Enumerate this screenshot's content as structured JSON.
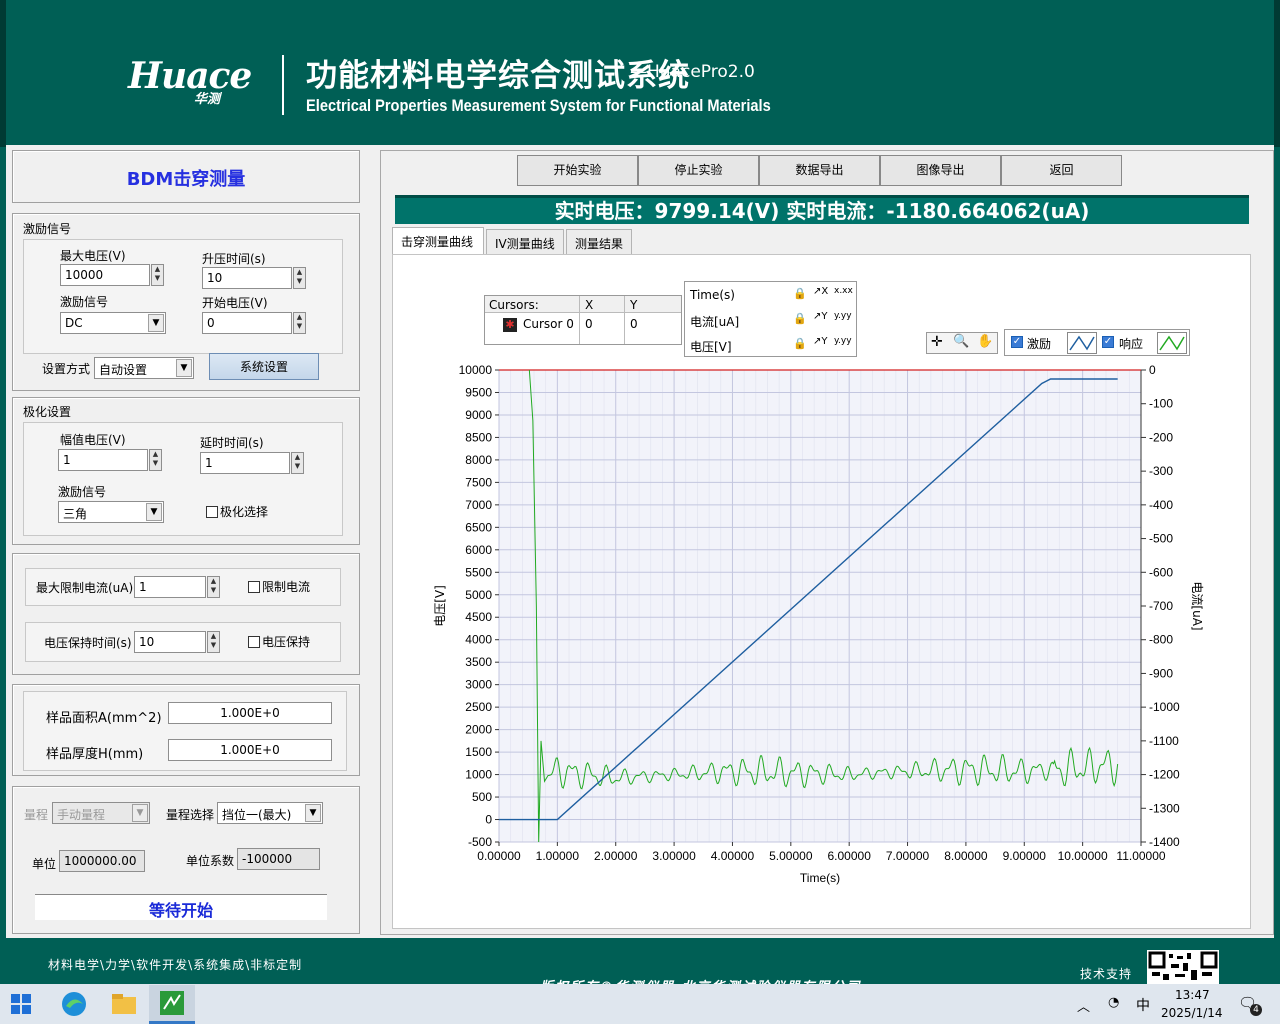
{
  "header": {
    "logo": "Huace",
    "logo_sub": "华测",
    "title_cn": "功能材料电学综合测试系统",
    "title_suffix": "—HuacePro2.0",
    "title_en": "Electrical Properties Measurement System for Functional Materials"
  },
  "left": {
    "page_title": "BDM击穿测量",
    "excitation": {
      "group": "激励信号",
      "max_voltage_label": "最大电压(V)",
      "max_voltage": "10000",
      "ramp_time_label": "升压时间(s)",
      "ramp_time": "10",
      "signal_label": "激励信号",
      "signal": "DC",
      "start_voltage_label": "开始电压(V)",
      "start_voltage": "0",
      "mode_label": "设置方式",
      "mode": "自动设置",
      "system_settings": "系统设置"
    },
    "polarization": {
      "group": "极化设置",
      "amp_label": "幅值电压(V)",
      "amp": "1",
      "delay_label": "延时时间(s)",
      "delay": "1",
      "signal_label": "激励信号",
      "signal": "三角",
      "select_label": "极化选择"
    },
    "limits": {
      "max_current_label": "最大限制电流(uA)",
      "max_current": "1",
      "limit_current_label": "限制电流",
      "hold_time_label": "电压保持时间(s)",
      "hold_time": "10",
      "hold_voltage_label": "电压保持"
    },
    "sample": {
      "area_label": "样品面积A(mm^2)",
      "area": "1.000E+0",
      "thickness_label": "样品厚度H(mm)",
      "thickness": "1.000E+0"
    },
    "range": {
      "range_label": "量程",
      "range": "手动量程",
      "select_label": "量程选择",
      "select": "挡位一(最大)",
      "unit_label": "单位",
      "unit": "1000000.00",
      "factor_label": "单位系数",
      "factor": "-100000",
      "status": "等待开始"
    }
  },
  "toolbar": [
    "开始实验",
    "停止实验",
    "数据导出",
    "图像导出",
    "返回"
  ],
  "realtime": "实时电压：9799.14(V) 实时电流：-1180.664062(uA)",
  "tabs": [
    "击穿测量曲线",
    "IV测量曲线",
    "测量结果"
  ],
  "cursors": {
    "header": "Cursors:",
    "col_x": "X",
    "col_y": "Y",
    "name": "Cursor 0",
    "x": "0",
    "y": "0"
  },
  "scales": {
    "rows": [
      "Time(s)",
      "电流[uA]",
      "电压[V]"
    ],
    "fmt": [
      "x.xx",
      "y.yy",
      "y.yy"
    ]
  },
  "legend": {
    "excitation": "激励",
    "response": "响应",
    "excitation_color": "#1f5fa0",
    "response_color": "#22aa22"
  },
  "chart_data": {
    "type": "line",
    "xlabel": "Time(s)",
    "ylabel": "电压[V]",
    "y2label": "电流[uA]",
    "xlim": [
      0,
      11
    ],
    "ylim": [
      -500,
      10000
    ],
    "y2lim": [
      -1400,
      0
    ],
    "x_ticks": [
      "0.00000",
      "1.00000",
      "2.00000",
      "3.00000",
      "4.00000",
      "5.00000",
      "6.00000",
      "7.00000",
      "8.00000",
      "9.00000",
      "10.00000",
      "11.00000"
    ],
    "y_ticks": [
      "-500",
      "0",
      "500",
      "1000",
      "1500",
      "2000",
      "2500",
      "3000",
      "3500",
      "4000",
      "4500",
      "5000",
      "5500",
      "6000",
      "6500",
      "7000",
      "7500",
      "8000",
      "8500",
      "9000",
      "9500",
      "10000"
    ],
    "y2_ticks": [
      "-1400",
      "-1300",
      "-1200",
      "-1100",
      "-1000",
      "-900",
      "-800",
      "-700",
      "-600",
      "-500",
      "-400",
      "-300",
      "-200",
      "-100",
      "0"
    ],
    "series": [
      {
        "name": "激励",
        "axis": "left",
        "x": [
          0,
          1.0,
          9.3,
          9.45,
          10.6
        ],
        "y": [
          0,
          0,
          9700,
          9800,
          9800
        ]
      },
      {
        "name": "响应",
        "axis": "right",
        "x": [
          0.52,
          0.58,
          0.64,
          0.68,
          0.72,
          0.78,
          0.85,
          1.0,
          2.0,
          3.0,
          4.0,
          5.0,
          6.0,
          7.0,
          8.0,
          9.0,
          10.0,
          10.6
        ],
        "y": [
          0,
          -150,
          -700,
          -1400,
          -1100,
          -1220,
          -1200,
          -1190,
          -1210,
          -1200,
          -1190,
          -1195,
          -1200,
          -1190,
          -1185,
          -1190,
          -1180,
          -1170
        ]
      }
    ]
  },
  "footer": {
    "services": "材料电学\\力学\\软件开发\\系统集成\\非标定制",
    "copyright": "版权所有©华测仪器 北京华测试验仪器有限公司",
    "support": "技术支持"
  },
  "taskbar": {
    "ime": "中",
    "time": "13:47",
    "date": "2025/1/14",
    "notif": "4"
  }
}
